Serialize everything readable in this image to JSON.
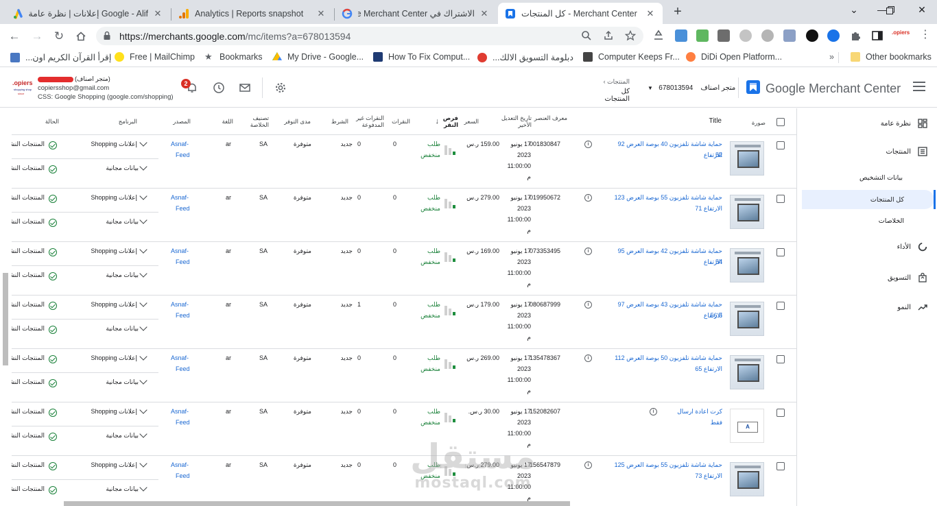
{
  "browser": {
    "tabs": [
      {
        "title": "Google - Alif إعلانات | نظرة عامة"
      },
      {
        "title": "Analytics | Reports snapshot"
      },
      {
        "title": "الاشتراك في Google Merchant Center"
      },
      {
        "title": "كل المنتجات - Merchant Center"
      }
    ],
    "url_host": "https://merchants.google.com",
    "url_rest": "/mc/items?a=678013594",
    "bookmarks": [
      {
        "label": "إقرأ القرآن الكريم اون..."
      },
      {
        "label": "Free | MailChimp"
      },
      {
        "label": "Bookmarks"
      },
      {
        "label": "My Drive - Google..."
      },
      {
        "label": "How To Fix Comput..."
      },
      {
        "label": "دبلومة التسويق الالك..."
      },
      {
        "label": "Computer Keeps Fr..."
      },
      {
        "label": "DiDi Open Platform..."
      }
    ],
    "bookmarks_more": "»",
    "other_bookmarks": "Other bookmarks"
  },
  "header": {
    "app_title": "Google Merchant Center",
    "account_name": "متجر اصناف",
    "account_id": "678013594",
    "crumb_parent": "المنتجات",
    "crumb_current": "كل المنتجات",
    "notif_count": "2",
    "user_label": "(متجر اصناف)",
    "user_email": "copiersshop@gmail.com",
    "user_css": "CSS: Google Shopping (google.com/shopping)"
  },
  "sidebar": {
    "overview": "نظرة عامة",
    "products": "المنتجات",
    "diagnostics": "بيانات التشخيص",
    "all_products": "كل المنتجات",
    "feeds": "الخلاصات",
    "performance": "الأداء",
    "marketing": "التسويق",
    "growth": "النمو"
  },
  "table": {
    "headers": {
      "image": "صورة",
      "title": "Title",
      "item_id": "معرف العنصر",
      "last_updated": "تاريخ التعديل الأخير",
      "price": "السعر",
      "click_potential": "فرص النقر",
      "clicks": "النقرات",
      "unpaid_clicks": "النقرات غير المدفوعة",
      "condition": "الشرط",
      "availability": "مدى التوفر",
      "feed_label": "تصنيف الخلاصة",
      "language": "اللغة",
      "source": "المصدر",
      "program": "البرنامج",
      "status": "الحالة"
    },
    "rows": [
      {
        "title1": "حماية شاشة تلفزيون 40 بوصة العرض 92 الارتفاع",
        "title2": "52",
        "id": "001830847",
        "price": "159.00 ر.س.",
        "clicks": "0",
        "unpaid": "0"
      },
      {
        "title1": "حماية شاشة تلفزيون 55 بوصة العرض 123",
        "title2": "الارتفاع 71",
        "id": "019950672",
        "price": "279.00 ر.س.",
        "clicks": "0",
        "unpaid": "0"
      },
      {
        "title1": "حماية شاشة تلفزيون 42 بوصة العرض 95 الارتفاع",
        "title2": "54",
        "id": "073353495",
        "price": "169.00 ر.س.",
        "clicks": "0",
        "unpaid": "0"
      },
      {
        "title1": "حماية شاشة تلفزيون 43 بوصة العرض 97 الارتفاع",
        "title2": "56.5",
        "id": "080687999",
        "price": "179.00 ر.س.",
        "clicks": "0",
        "unpaid": "1"
      },
      {
        "title1": "حماية شاشة تلفزيون 50 بوصة العرض 112",
        "title2": "الارتفاع 65",
        "id": "135478367",
        "price": "269.00 ر.س.",
        "clicks": "0",
        "unpaid": "0"
      },
      {
        "title1": "كرت اعادة ارسال فقط",
        "title2": "",
        "id": "152082607",
        "price": "30.00 ر.س.",
        "clicks": "0",
        "unpaid": "0"
      },
      {
        "title1": "حماية شاشة تلفزيون 55 بوصة العرض 125",
        "title2": "الارتفاع 73",
        "id": "156547879",
        "price": "279.00 ر.س.",
        "clicks": "0",
        "unpaid": "0"
      }
    ],
    "common": {
      "date1": "17 يونيو",
      "date2": "2023",
      "date3": "11:00:00",
      "date4": "م",
      "potential1": "طلب",
      "potential2": "منخفض",
      "condition": "جديد",
      "availability": "متوفرة",
      "feed_label": "SA",
      "language": "ar",
      "source1": "Asnaf-",
      "source2": "Feed",
      "program_ads": "إعلانات Shopping",
      "program_free": "بيانات مجانية",
      "status": "المنتجات النشطة"
    }
  },
  "watermark": {
    "line1": "مستقل",
    "line2": "mostaql.com"
  },
  "colors": {
    "accent": "#1a73e8",
    "link": "#1967d2",
    "success": "#188038",
    "badge": "#d93025"
  }
}
